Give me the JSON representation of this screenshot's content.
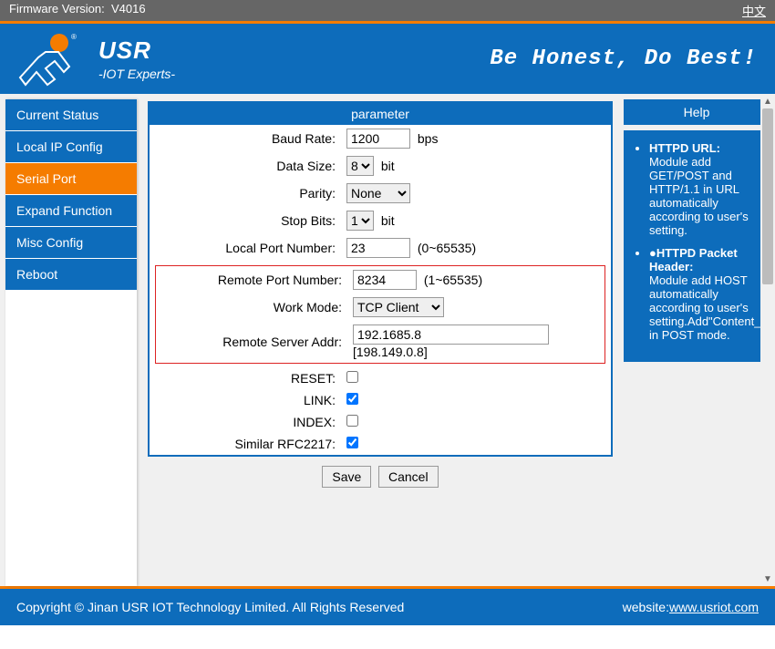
{
  "top": {
    "fw_label": "Firmware Version:",
    "fw_value": "V4016",
    "lang": "中文"
  },
  "header": {
    "brand": "USR",
    "tagline": "-IOT Experts-",
    "slogan": "Be Honest, Do Best!"
  },
  "nav": {
    "items": [
      {
        "label": "Current Status"
      },
      {
        "label": "Local IP Config"
      },
      {
        "label": "Serial Port"
      },
      {
        "label": "Expand Function"
      },
      {
        "label": "Misc Config"
      },
      {
        "label": "Reboot"
      }
    ]
  },
  "panel": {
    "title": "parameter",
    "baud_label": "Baud Rate:",
    "baud_value": "1200",
    "baud_unit": "bps",
    "data_label": "Data Size:",
    "data_value": "8",
    "data_unit": "bit",
    "parity_label": "Parity:",
    "parity_value": "None",
    "stop_label": "Stop Bits:",
    "stop_value": "1",
    "stop_unit": "bit",
    "lport_label": "Local Port Number:",
    "lport_value": "23",
    "lport_hint": "(0~65535)",
    "rport_label": "Remote Port Number:",
    "rport_value": "8234",
    "rport_hint": "(1~65535)",
    "mode_label": "Work Mode:",
    "mode_value": "TCP Client",
    "raddr_label": "Remote Server Addr:",
    "raddr_value": "192.1685.8",
    "raddr_example": "[198.149.0.8]",
    "reset_label": "RESET:",
    "link_label": "LINK:",
    "index_label": "INDEX:",
    "rfc_label": "Similar RFC2217:",
    "save": "Save",
    "cancel": "Cancel"
  },
  "help": {
    "title": "Help",
    "b1_title": "HTTPD URL:",
    "b1_text": "Module add GET/POST and HTTP/1.1 in URL automatically according to user's setting.",
    "b2_title": "●HTTPD Packet Header:",
    "b2_text": "Module add HOST automatically according to user's setting.Add\"Content_Length\"automatically in POST mode."
  },
  "footer": {
    "copy": "Copyright © Jinan USR IOT Technology Limited. All Rights Reserved",
    "site_label": "website:",
    "site_link": "www.usriot.com"
  }
}
